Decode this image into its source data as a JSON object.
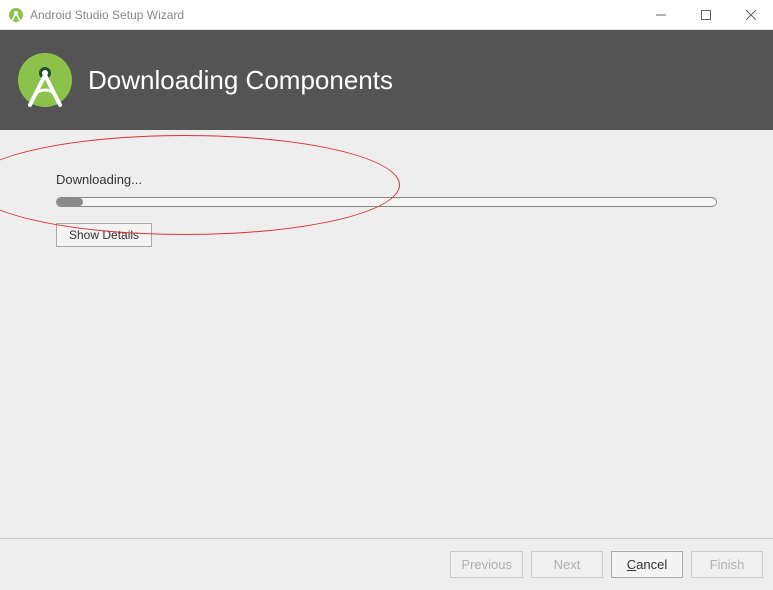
{
  "window": {
    "title": "Android Studio Setup Wizard"
  },
  "header": {
    "title": "Downloading Components"
  },
  "content": {
    "status_label": "Downloading...",
    "progress_percent": 4,
    "show_details_label": "Show Details"
  },
  "footer": {
    "previous_label": "Previous",
    "next_label": "Next",
    "cancel_label": "Cancel",
    "finish_label": "Finish"
  },
  "colors": {
    "accent_green": "#8bc34a",
    "banner_grey": "#545454",
    "annotation_red": "#e03030"
  }
}
